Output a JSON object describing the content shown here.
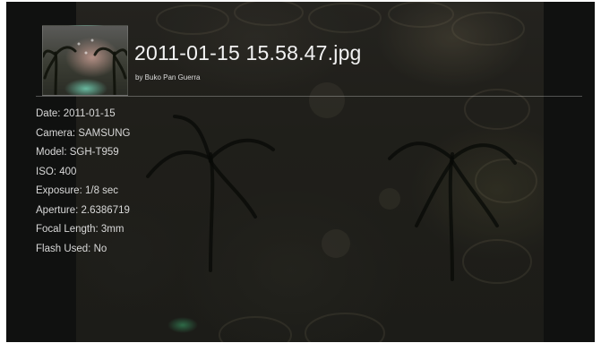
{
  "photo_info": {
    "file_name": "2011-01-15 15.58.47.jpg",
    "author": "by Buko Pan Guerra",
    "details": [
      {
        "label": "Date:",
        "value": "2011-01-15"
      },
      {
        "label": "Camera:",
        "value": "SAMSUNG"
      },
      {
        "label": "Model:",
        "value": "SGH-T959"
      },
      {
        "label": "ISO:",
        "value": "400"
      },
      {
        "label": "Exposure:",
        "value": "1/8 sec"
      },
      {
        "label": "Aperture:",
        "value": "2.6386719"
      },
      {
        "label": "Focal Length:",
        "value": "3mm"
      },
      {
        "label": "Flash Used:",
        "value": "No"
      }
    ]
  },
  "colors": {
    "background": "#0d0e0d",
    "text": "#d9d9d9",
    "title": "#f2f2f2"
  }
}
